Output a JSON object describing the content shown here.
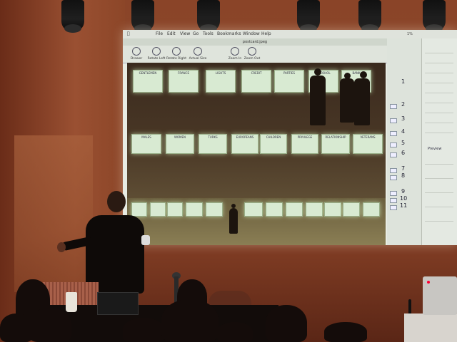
{
  "menubar": {
    "items": [
      "File",
      "Edit",
      "View",
      "Go",
      "Tools",
      "Bookmarks",
      "Window",
      "Help"
    ],
    "status": "1%"
  },
  "window": {
    "title": "postcard.jpeg"
  },
  "toolbar": {
    "buttons": [
      "Drawer",
      "Rotate Left",
      "Rotate Right",
      "Actual Size",
      "Zoom In",
      "Zoom Out"
    ]
  },
  "photo_signs": {
    "row1": [
      "GENTLEMEN",
      "FRANCE",
      "LIGHTS",
      "CREDIT",
      "PARTIES",
      "ALCOHOL",
      "BANK"
    ],
    "row2": [
      "MALES",
      "WOMEN",
      "TURKS",
      "EUROPEANS",
      "CHILDREN",
      "PRIVILEGE",
      "RELATIONSHIP",
      "VETERANS"
    ]
  },
  "sidebar": {
    "page_numbers": [
      "1",
      "2",
      "3",
      "4",
      "5",
      "6",
      "7",
      "8",
      "9",
      "10",
      "11"
    ]
  },
  "right_pane": {
    "label": "Preview"
  }
}
